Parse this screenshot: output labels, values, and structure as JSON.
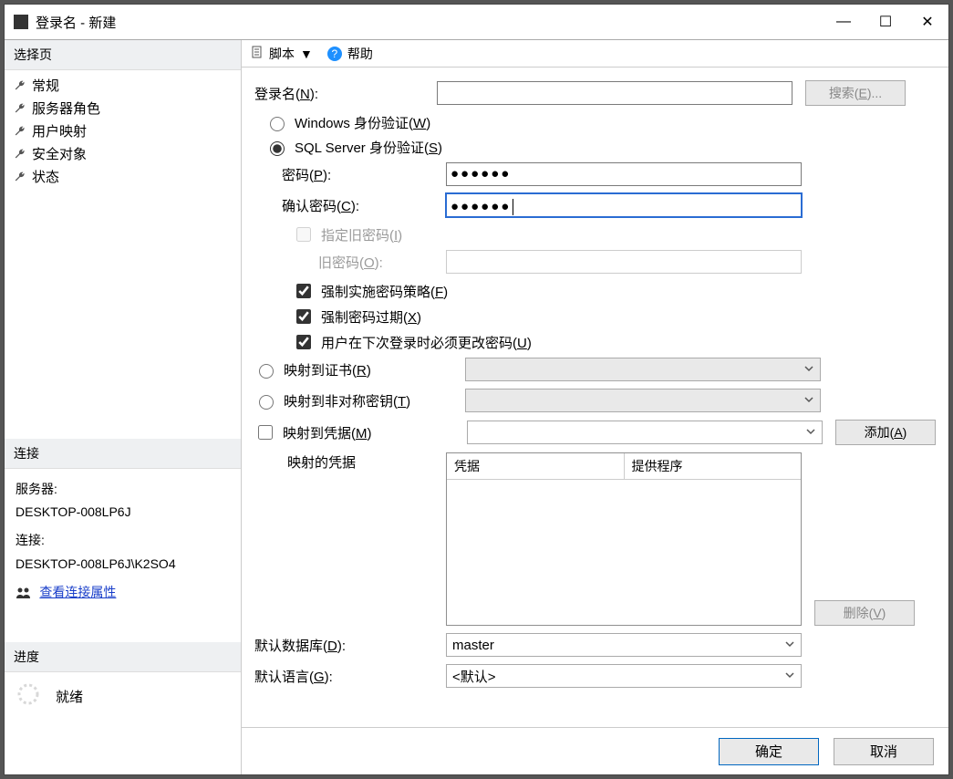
{
  "window": {
    "title": "登录名 - 新建"
  },
  "titlebar_btns": {
    "min": "—",
    "max": "☐",
    "close": "✕"
  },
  "sidebar": {
    "head_select_page": "选择页",
    "pages": {
      "general": "常规",
      "server_roles": "服务器角色",
      "user_map": "用户映射",
      "securables": "安全对象",
      "status": "状态"
    },
    "head_connection": "连接",
    "conn": {
      "server_lbl": "服务器:",
      "server_val": "DESKTOP-008LP6J",
      "conn_lbl": "连接:",
      "conn_val": "DESKTOP-008LP6J\\K2SO4",
      "view_props": "查看连接属性"
    },
    "head_progress": "进度",
    "progress": {
      "status": "就绪"
    }
  },
  "toolbar": {
    "script": "脚本",
    "help": "帮助"
  },
  "form": {
    "login_name": {
      "label_pre": "登录名(",
      "u": "N",
      "label_post": "):",
      "value": ""
    },
    "search_btn": {
      "pre": "搜索(",
      "u": "E",
      "post": ")..."
    },
    "auth_win": {
      "pre": "Windows 身份验证(",
      "u": "W",
      "post": ")"
    },
    "auth_sql": {
      "pre": "SQL Server 身份验证(",
      "u": "S",
      "post": ")"
    },
    "pwd": {
      "pre": "密码(",
      "u": "P",
      "post": "):",
      "value": "●●●●●●"
    },
    "pwd2": {
      "pre": "确认密码(",
      "u": "C",
      "post": "):",
      "value": "●●●●●●"
    },
    "oldpwd_chk": {
      "pre": "指定旧密码(",
      "u": "I",
      "post": ")"
    },
    "oldpwd": {
      "pre": "旧密码(",
      "u": "O",
      "post": "):",
      "value": ""
    },
    "enforce_policy": {
      "pre": "强制实施密码策略(",
      "u": "F",
      "post": ")"
    },
    "enforce_expire": {
      "pre": "强制密码过期(",
      "u": "X",
      "post": ")"
    },
    "must_change": {
      "pre": "用户在下次登录时必须更改密码(",
      "u": "U",
      "post": ")"
    },
    "map_cert": {
      "pre": "映射到证书(",
      "u": "R",
      "post": ")"
    },
    "map_asym": {
      "pre": "映射到非对称密钥(",
      "u": "T",
      "post": ")"
    },
    "map_cred": {
      "pre": "映射到凭据(",
      "u": "M",
      "post": ")"
    },
    "add_btn": {
      "pre": "添加(",
      "u": "A",
      "post": ")"
    },
    "mapped_creds_label": "映射的凭据",
    "cred_cols": {
      "c1": "凭据",
      "c2": "提供程序"
    },
    "remove_btn": {
      "pre": "删除(",
      "u": "V",
      "post": ")"
    },
    "default_db": {
      "pre": "默认数据库(",
      "u": "D",
      "post": "):",
      "value": "master"
    },
    "default_lang": {
      "pre": "默认语言(",
      "u": "G",
      "post": "):",
      "value": "<默认>"
    }
  },
  "footer": {
    "ok": "确定",
    "cancel": "取消"
  }
}
